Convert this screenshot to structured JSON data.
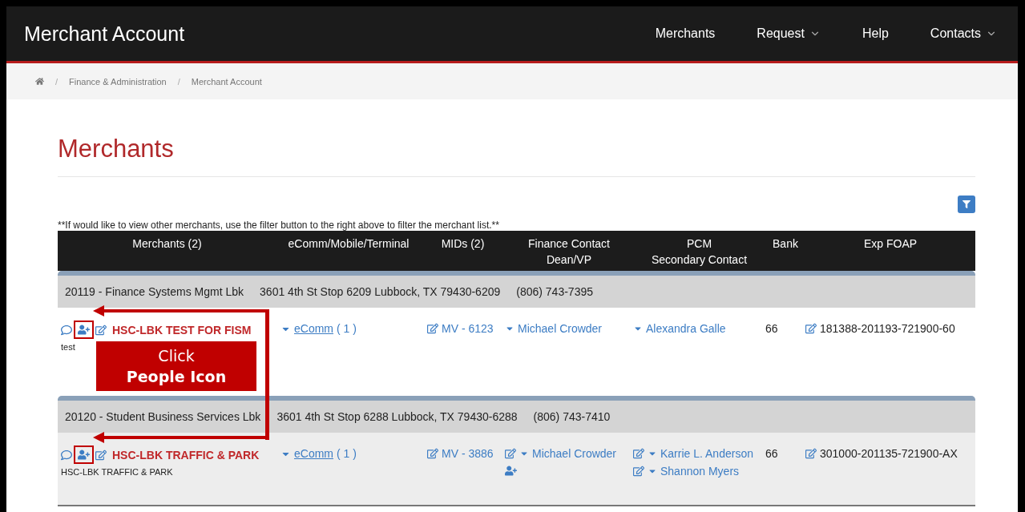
{
  "nav": {
    "brand": "Merchant Account",
    "items": [
      {
        "label": "Merchants",
        "dropdown": false
      },
      {
        "label": "Request",
        "dropdown": true
      },
      {
        "label": "Help",
        "dropdown": false
      },
      {
        "label": "Contacts",
        "dropdown": true
      }
    ]
  },
  "breadcrumb": {
    "separator": "/",
    "items": [
      "Finance & Administration",
      "Merchant Account"
    ]
  },
  "page_title": "Merchants",
  "note": "**If would like to view other merchants, use the filter button to the right above to filter the merchant list.**",
  "table": {
    "columns": [
      [
        "Merchants (2)"
      ],
      [
        "eComm/Mobile/Terminal"
      ],
      [
        "MIDs (2)"
      ],
      [
        "Finance Contact",
        "Dean/VP"
      ],
      [
        "PCM",
        "Secondary Contact"
      ],
      [
        "Bank"
      ],
      [
        "Exp FOAP"
      ]
    ],
    "groups": [
      {
        "header": [
          "20119 - Finance Systems Mgmt Lbk",
          "3601 4th St Stop 6209 Lubbock, TX 79430-6209",
          "(806) 743-7395"
        ],
        "highlighted": false,
        "marked": true,
        "merchant": "HSC-LBK TEST FOR FISM",
        "subtitle": "test",
        "ecomm": "eComm",
        "ecomm_count": "( 1 )",
        "mid": "MV - 6123",
        "finance": {
          "name": "Michael Crowder",
          "editable": false,
          "add_person": false
        },
        "pcm": [
          {
            "name": "Alexandra Galle",
            "editable": false
          }
        ],
        "bank": "66",
        "foap": "181388-201193-721900-60"
      },
      {
        "header": [
          "20120 - Student Business Services Lbk",
          "3601 4th St Stop 6288 Lubbock, TX 79430-6288",
          "(806) 743-7410"
        ],
        "highlighted": true,
        "marked": true,
        "merchant": "HSC-LBK TRAFFIC & PARK",
        "subtitle": "HSC-LBK TRAFFIC & PARK",
        "ecomm": "eComm",
        "ecomm_count": "( 1 )",
        "mid": "MV - 3886",
        "finance": {
          "name": "Michael Crowder",
          "editable": true,
          "add_person": true
        },
        "pcm": [
          {
            "name": "Karrie L. Anderson",
            "editable": true
          },
          {
            "name": "Shannon Myers",
            "editable": true
          }
        ],
        "bank": "66",
        "foap": "301000-201135-721900-AX"
      }
    ]
  },
  "callout": {
    "line_1": "Click",
    "line_2": "People Icon"
  }
}
